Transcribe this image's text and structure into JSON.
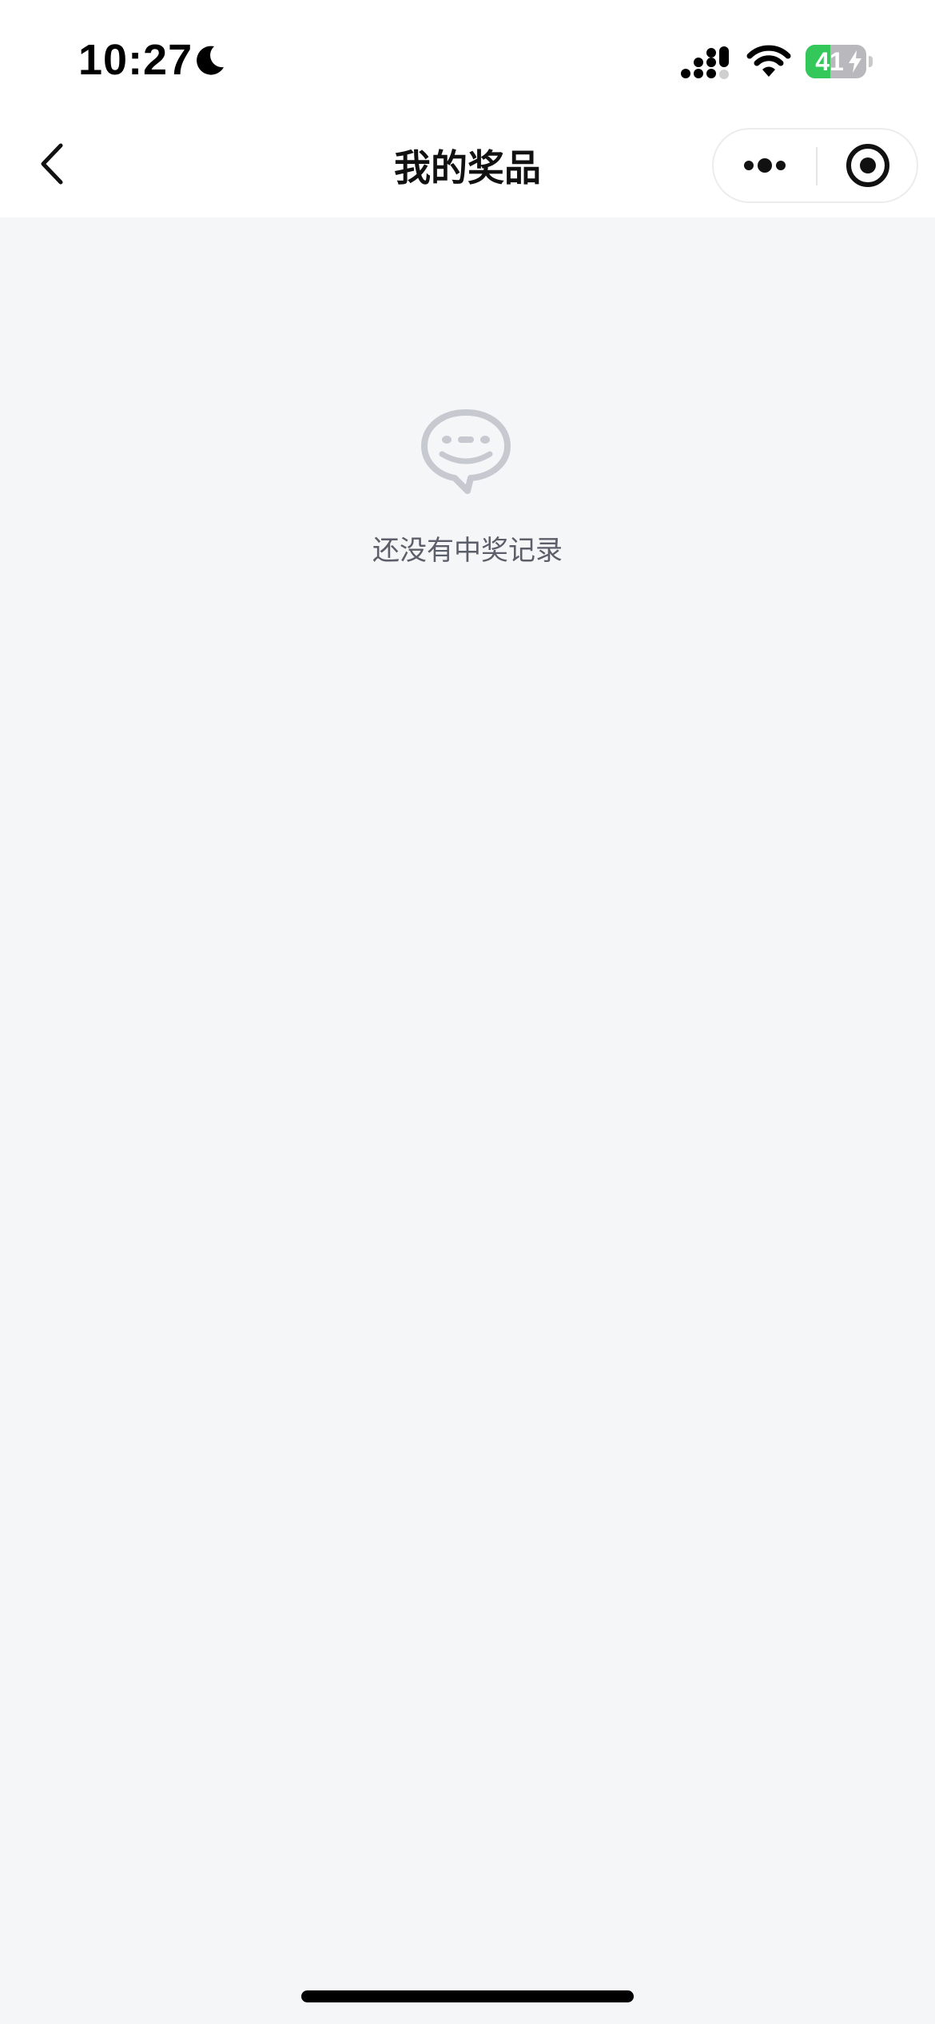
{
  "status_bar": {
    "time": "10:27",
    "battery_level": "41",
    "battery_fraction": 0.41
  },
  "nav": {
    "title": "我的奖品"
  },
  "empty_state": {
    "message": "还没有中奖记录"
  },
  "icons": {
    "moon": "moon-icon",
    "signal": "signal-icon",
    "wifi": "wifi-icon",
    "battery": "battery-icon",
    "back": "chevron-left-icon",
    "more": "more-dots-icon",
    "close": "close-target-icon",
    "empty": "smiley-chat-bubble-icon"
  },
  "colors": {
    "background": "#f5f6f8",
    "bar_background": "#ffffff",
    "battery_green": "#34c759",
    "empty_icon": "#c6c9cf",
    "empty_text": "#5b5f69"
  }
}
